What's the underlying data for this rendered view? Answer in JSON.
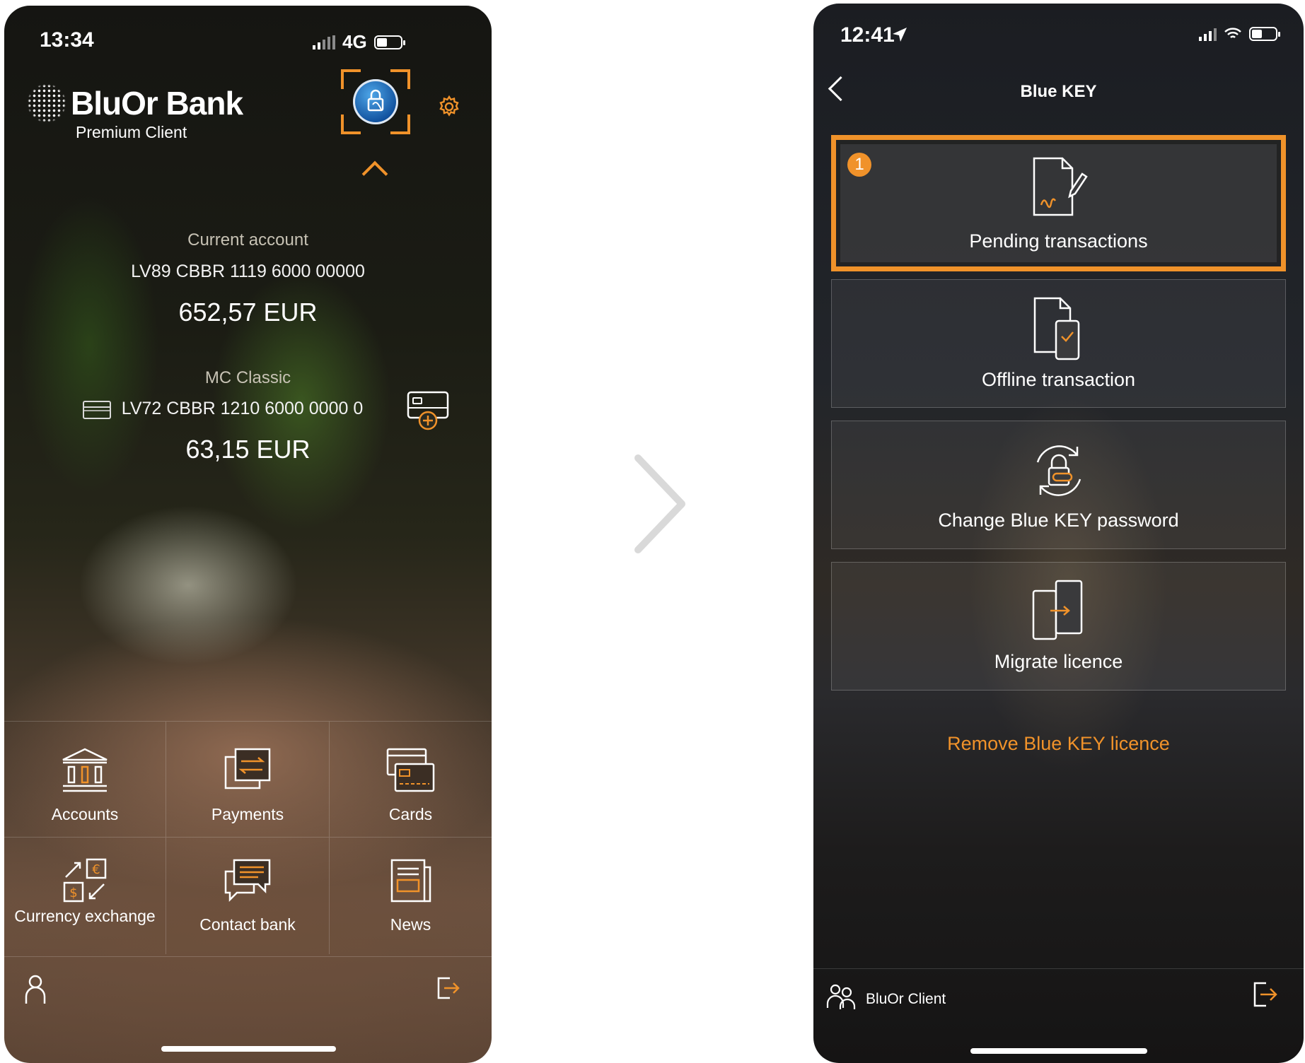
{
  "left_screen": {
    "status_bar": {
      "time": "13:34",
      "network": "4G"
    },
    "logo": {
      "name": "BluOr Bank",
      "subtitle": "Premium Client"
    },
    "header_icons": [
      "blue-key-icon",
      "gear-icon"
    ],
    "accounts": [
      {
        "label": "Current account",
        "iban": "LV89 CBBR 1119 6000 00000",
        "balance": "652,57 EUR"
      },
      {
        "label": "MC Classic",
        "iban": "LV72 CBBR 1210 6000 0000 0",
        "balance": "63,15 EUR"
      }
    ],
    "menu": [
      {
        "label": "Accounts",
        "icon": "bank-icon"
      },
      {
        "label": "Payments",
        "icon": "payments-icon"
      },
      {
        "label": "Cards",
        "icon": "cards-icon"
      },
      {
        "label": "Currency exchange",
        "icon": "currency-exchange-icon"
      },
      {
        "label": "Contact bank",
        "icon": "chat-icon"
      },
      {
        "label": "News",
        "icon": "news-icon"
      }
    ]
  },
  "right_screen": {
    "status_bar": {
      "time": "12:41"
    },
    "nav": {
      "title": "Blue KEY"
    },
    "options": [
      {
        "label": "Pending transactions",
        "icon": "document-sign-icon",
        "step": "1"
      },
      {
        "label": "Offline transaction",
        "icon": "offline-transaction-icon"
      },
      {
        "label": "Change Blue KEY password",
        "icon": "lock-refresh-icon"
      },
      {
        "label": "Migrate licence",
        "icon": "migrate-devices-icon"
      }
    ],
    "remove_link": "Remove Blue KEY licence",
    "footer": {
      "client": "BluOr Client"
    }
  },
  "colors": {
    "accent": "#f0922a",
    "text": "#ffffff"
  }
}
